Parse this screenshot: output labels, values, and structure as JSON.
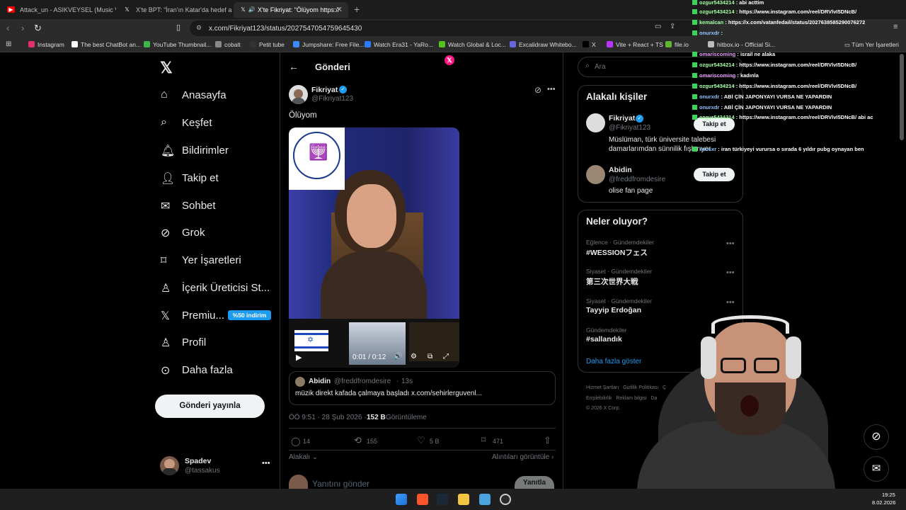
{
  "browser": {
    "tabs": [
      {
        "title": "Attack_un - ASIKVEYSEL (Music Vide...",
        "icon": "youtube-icon",
        "active": false
      },
      {
        "title": "X'te BPT: \"İran'ın Katar'da hedef aldığı",
        "icon": "x-logo-icon",
        "active": false
      },
      {
        "title": "X'te Fikriyat: \"Ölüyom https://",
        "icon": "x-logo-icon",
        "active": true
      }
    ],
    "url": "x.com/Fikriyat123/status/2027547054759645430",
    "bookmarks": [
      {
        "label": "Instagram",
        "color": "#e1306c"
      },
      {
        "label": "The best ChatBot an...",
        "color": "#ffffff"
      },
      {
        "label": "YouTube Thumbnail...",
        "color": "#3bb54a"
      },
      {
        "label": "cobalt",
        "color": "#888888"
      },
      {
        "label": "Petit tube",
        "color": "#333333"
      },
      {
        "label": "Jumpshare: Free File...",
        "color": "#3a8bff"
      },
      {
        "label": "Watch Era31 - YaRo...",
        "color": "#2b7bff"
      },
      {
        "label": "Watch Global & Loc...",
        "color": "#52c41a"
      },
      {
        "label": "Excalidraw Whitebo...",
        "color": "#6965db"
      },
      {
        "label": "X",
        "color": "#000000"
      },
      {
        "label": "Vite + React + TS",
        "color": "#bd34fe"
      },
      {
        "label": "file.io",
        "color": "#62b32e"
      },
      {
        "label": "hitbox.io - Official Si...",
        "color": "#bbbbbb"
      }
    ],
    "all_bookmarks": "Tüm Yer İşaretleri"
  },
  "sidebar": {
    "items": [
      {
        "label": "Anasayfa",
        "icon": "home-icon"
      },
      {
        "label": "Keşfet",
        "icon": "search-icon"
      },
      {
        "label": "Bildirimler",
        "icon": "bell-icon"
      },
      {
        "label": "Takip et",
        "icon": "person-add-icon"
      },
      {
        "label": "Sohbet",
        "icon": "mail-icon"
      },
      {
        "label": "Grok",
        "icon": "grok-icon"
      },
      {
        "label": "Yer İşaretleri",
        "icon": "bookmark-icon"
      },
      {
        "label": "İçerik Üreticisi St...",
        "icon": "creator-studio-icon"
      },
      {
        "label": "Premiu...",
        "icon": "x-logo-icon"
      },
      {
        "label": "Profil",
        "icon": "person-icon"
      },
      {
        "label": "Daha fazla",
        "icon": "more-circle-icon"
      }
    ],
    "premium_badge": "%50 indirim",
    "post_button": "Gönderi yayınla",
    "account": {
      "name": "Spadev",
      "handle": "@tassakus"
    }
  },
  "post": {
    "header_title": "Gönderi",
    "author_name": "Fikriyat",
    "author_handle": "@Fikriyat123",
    "text": "Ölüyom",
    "video_time": "0:01 / 0:12",
    "quote": {
      "author_name": "Abidin",
      "author_handle": "@freddfromdesire",
      "time": "13s",
      "text": "müzik direkt kafada çalmaya başladı x.com/sehirlerguvenl..."
    },
    "meta_time": "ÖÖ 9:51 · 28 Şub 2026 ·",
    "views_count": "152 B",
    "views_label": "Görüntüleme",
    "replies": "14",
    "reposts": "155",
    "likes": "5 B",
    "bookmarks": "471",
    "related_label": "Alakalı",
    "quotes_label": "Alıntıları görüntüle",
    "reply_placeholder": "Yanıtını gönder",
    "reply_button": "Yanıtla"
  },
  "right": {
    "search_placeholder": "Ara",
    "relevant_title": "Alakalı kişiler",
    "people": [
      {
        "name": "Fikriyat",
        "handle": "@Fikriyat123",
        "bio": "Müslüman, türk üniversite talebesi damarlarımdan sünnilik fışkırıyor",
        "follow": "Takip et"
      },
      {
        "name": "Abidin",
        "handle": "@freddfromdesire",
        "bio": "olise fan page",
        "follow": "Takip et"
      }
    ],
    "trends_title": "Neler oluyor?",
    "trends": [
      {
        "category": "Eğlence · Gündemdekiler",
        "name": "#WESSIONフェス"
      },
      {
        "category": "Siyaset · Gündemdekiler",
        "name": "第三次世界大戦"
      },
      {
        "category": "Siyaset · Gündemdekiler",
        "name": "Tayyip Erdoğan"
      },
      {
        "category": "Gündemdekiler",
        "name": "#sallandık"
      }
    ],
    "show_more": "Daha fazla göster",
    "footer_line1": "Hizmet Şartları   Gizlilik Politikası   Ç",
    "footer_line2": "Erişilebilirlik   Reklam bilgisi   Da",
    "footer_line3": "© 2026 X Corp."
  },
  "chat": [
    {
      "user": "ozgur5434214",
      "msg": ": abi acttim",
      "color": "g"
    },
    {
      "user": "ozgur5434214",
      "msg": ": https://www.instagram.com/reel/DRVlvI5DNcB/",
      "color": "g"
    },
    {
      "user": "kemalcan",
      "msg": ": https://x.com/vatanfedail/status/2027638585290076272",
      "color": "g"
    },
    {
      "user": "onurxdr",
      "msg": ":",
      "color": "b"
    },
    {
      "user": "omariscoming",
      "msg": ": israil ne alaka",
      "color": "p"
    },
    {
      "user": "ozgur5434214",
      "msg": ": https://www.instagram.com/reel/DRVlvI5DNcB/",
      "color": "g"
    },
    {
      "user": "omariscoming",
      "msg": ": kadınla",
      "color": "p"
    },
    {
      "user": "ozgur5434214",
      "msg": ": https://www.instagram.com/reel/DRVlvI5DNcB/",
      "color": "g"
    },
    {
      "user": "onurxdr",
      "msg": ": ABİ ÇİN JAPONYAYI VURSA NE YAPARDIN",
      "color": "b"
    },
    {
      "user": "onurxdr",
      "msg": ": ABİ ÇİN JAPONYAYI VURSA NE YAPARDIN",
      "color": "b"
    },
    {
      "user": "ozgur5434214",
      "msg": ": https://www.instagram.com/reel/DRVlvI5DNcB/ abi ac",
      "color": "g"
    },
    {
      "user": "kaosxr",
      "msg": ": iran türkiyeyi vurursa o sırada 6 yıldır pubg oynayan ben",
      "color": "b"
    }
  ],
  "taskbar": {
    "time": "19:25",
    "date": "8.02.2026"
  }
}
